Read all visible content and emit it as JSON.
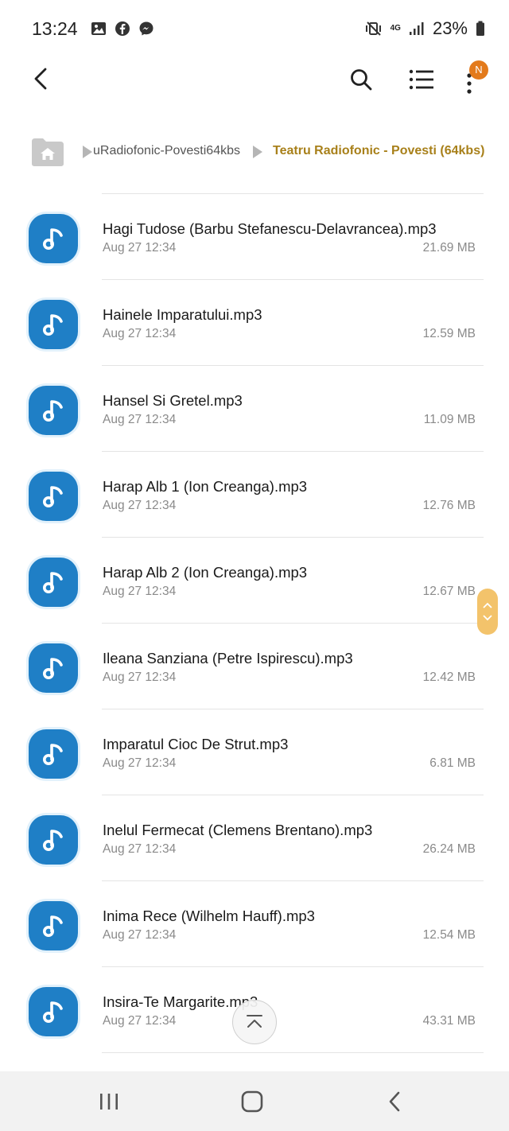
{
  "status_bar": {
    "time": "13:24",
    "notification_icons": [
      "gallery-icon",
      "facebook-icon",
      "messenger-icon"
    ],
    "network": "4G",
    "battery": "23%"
  },
  "app_bar": {
    "badge": "N"
  },
  "breadcrumb": {
    "items": [
      "uRadiofonic-Povesti64kbs",
      "Teatru Radiofonic - Povesti (64kbs)"
    ]
  },
  "files": [
    {
      "name": "Hagi Tudose (Barbu Stefanescu-Delavrancea).mp3",
      "date": "Aug 27 12:34",
      "size": "21.69 MB"
    },
    {
      "name": "Hainele Imparatului.mp3",
      "date": "Aug 27 12:34",
      "size": "12.59 MB"
    },
    {
      "name": "Hansel Si Gretel.mp3",
      "date": "Aug 27 12:34",
      "size": "11.09 MB"
    },
    {
      "name": "Harap Alb 1 (Ion Creanga).mp3",
      "date": "Aug 27 12:34",
      "size": "12.76 MB"
    },
    {
      "name": "Harap Alb 2 (Ion Creanga).mp3",
      "date": "Aug 27 12:34",
      "size": "12.67 MB"
    },
    {
      "name": "Ileana Sanziana (Petre Ispirescu).mp3",
      "date": "Aug 27 12:34",
      "size": "12.42 MB"
    },
    {
      "name": "Imparatul Cioc De Strut.mp3",
      "date": "Aug 27 12:34",
      "size": "6.81 MB"
    },
    {
      "name": "Inelul Fermecat (Clemens Brentano).mp3",
      "date": "Aug 27 12:34",
      "size": "26.24 MB"
    },
    {
      "name": "Inima Rece (Wilhelm Hauff).mp3",
      "date": "Aug 27 12:34",
      "size": "12.54 MB"
    },
    {
      "name": "Insira-Te Margarite.mp3",
      "date": "Aug 27 12:34",
      "size": "43.31 MB"
    }
  ],
  "colors": {
    "accent": "#a8801a",
    "file_icon": "#1f7fc6",
    "badge": "#e37a1b",
    "fast_scroll": "#f3c36b"
  }
}
